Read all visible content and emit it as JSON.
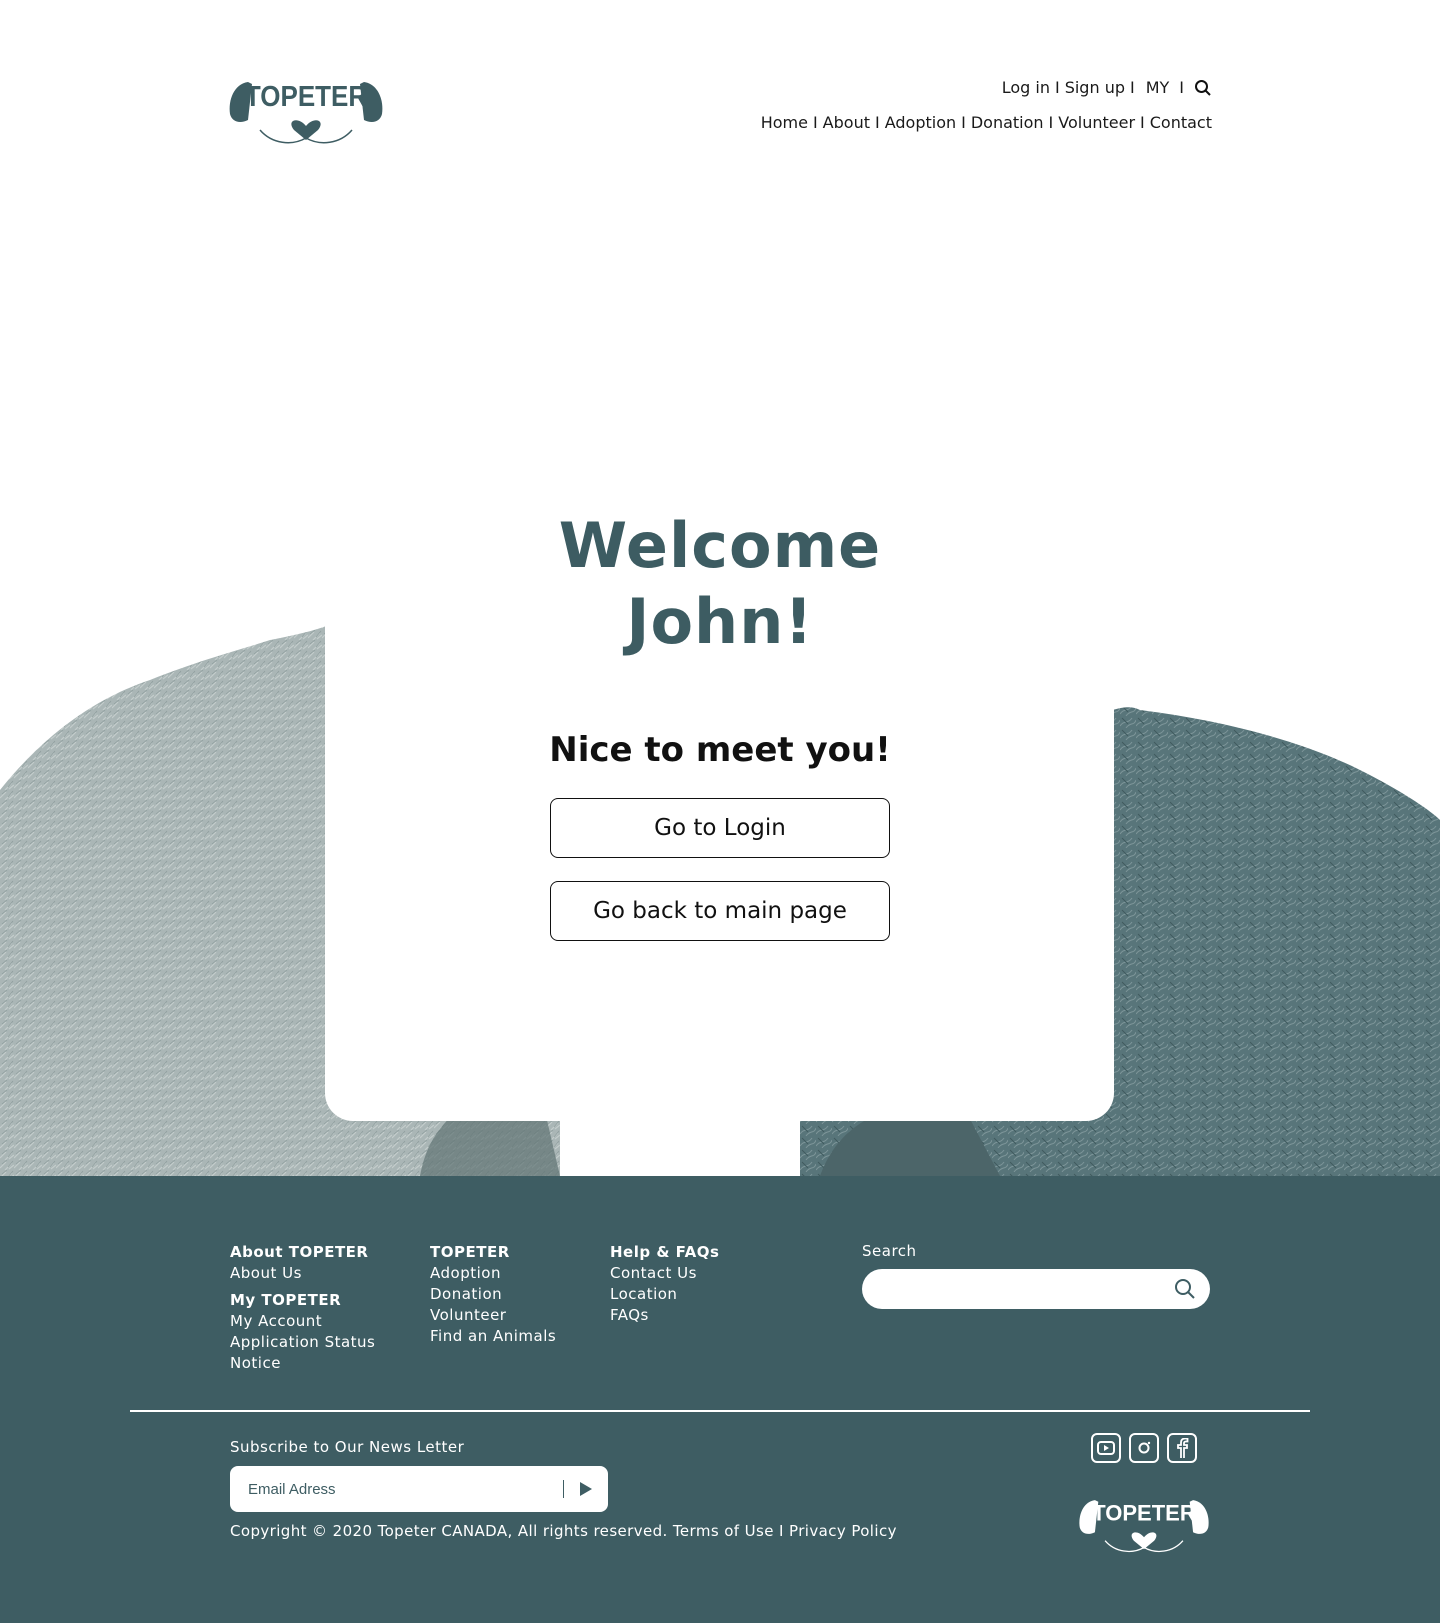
{
  "brand": {
    "name": "TOPETER",
    "primary_color": "#3e5d63"
  },
  "header": {
    "top_links": {
      "login": "Log in",
      "signup": "Sign up",
      "my": "MY",
      "separator": "I"
    },
    "nav": {
      "home": "Home",
      "about": "About",
      "adoption": "Adoption",
      "donation": "Donation",
      "volunteer": "Volunteer",
      "contact": "Contact"
    }
  },
  "main": {
    "welcome_line1": "Welcome",
    "welcome_line2": "John!",
    "subtitle": "Nice to meet you!",
    "login_button": "Go to Login",
    "main_page_button": "Go back to main page"
  },
  "footer": {
    "columns": [
      {
        "sections": [
          {
            "heading": "About TOPETER",
            "items": [
              "About Us"
            ]
          },
          {
            "heading": "My TOPETER",
            "items": [
              "My Account",
              "Application Status",
              "Notice"
            ]
          }
        ]
      },
      {
        "sections": [
          {
            "heading": "TOPETER",
            "items": [
              "Adoption",
              "Donation",
              "Volunteer",
              "Find an Animals"
            ]
          }
        ]
      },
      {
        "sections": [
          {
            "heading": "Help & FAQs",
            "items": [
              "Contact Us",
              "Location",
              "FAQs"
            ]
          }
        ]
      }
    ],
    "search_label": "Search",
    "search_value": "",
    "subscribe_label": "Subscribe to Our News Letter",
    "email_placeholder": "Email Adress",
    "copyright": "Copyright © 2020 Topeter CANADA, All rights reserved. Terms of Use I Privacy Policy",
    "social_icons": [
      "youtube-icon",
      "instagram-icon",
      "facebook-icon"
    ]
  }
}
